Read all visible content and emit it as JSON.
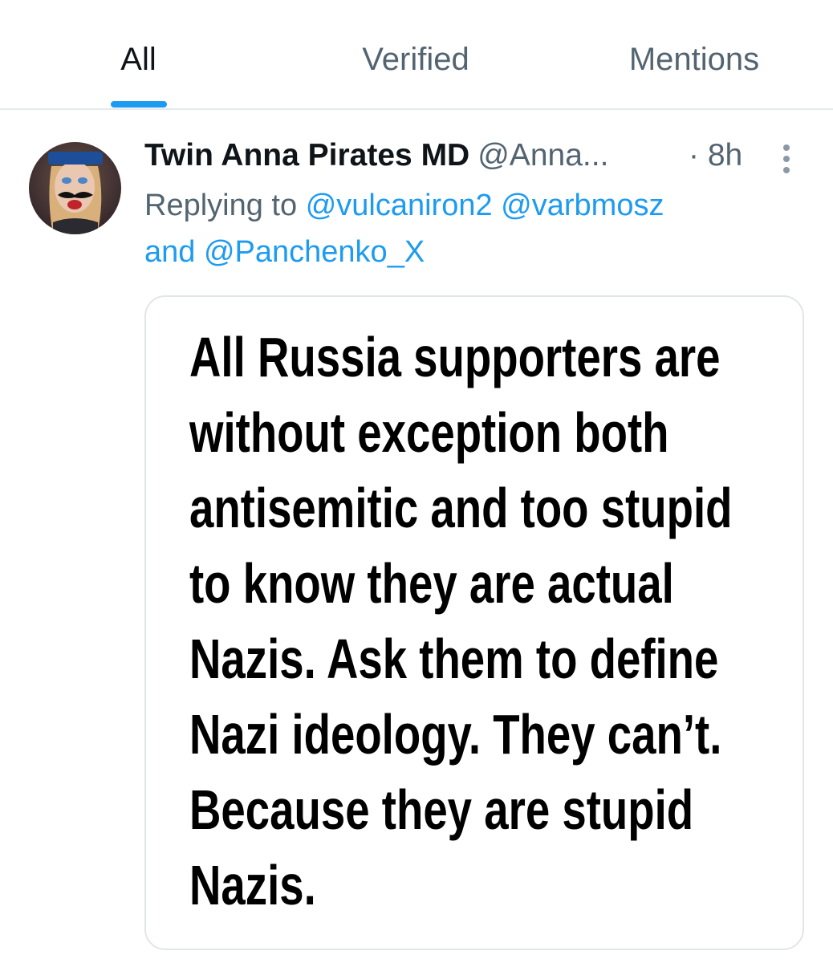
{
  "tabs": [
    {
      "label": "All",
      "active": true
    },
    {
      "label": "Verified",
      "active": false
    },
    {
      "label": "Mentions",
      "active": false
    }
  ],
  "colors": {
    "accent": "#1d9bf0",
    "text_primary": "#0f1419",
    "text_secondary": "#536471",
    "divider": "#e6e9ec"
  },
  "tweet": {
    "avatar_icon": "user-avatar",
    "display_name": "Twin Anna Pirates MD",
    "handle": "@Anna...",
    "time": "· 8h",
    "more_icon": "more-vertical-icon",
    "replying_prefix": "Replying to",
    "mentions": [
      "@vulcaniron2",
      "@varbmosz",
      "@Panchenko_X"
    ],
    "and_word": "and",
    "media_lines": [
      "All Russia supporters are",
      "without exception both",
      "antisemitic and too stupid",
      "to know they are actual",
      "Nazis.  Ask them to define",
      "Nazi ideology. They can’t.",
      "Because they are stupid",
      "Nazis."
    ]
  }
}
